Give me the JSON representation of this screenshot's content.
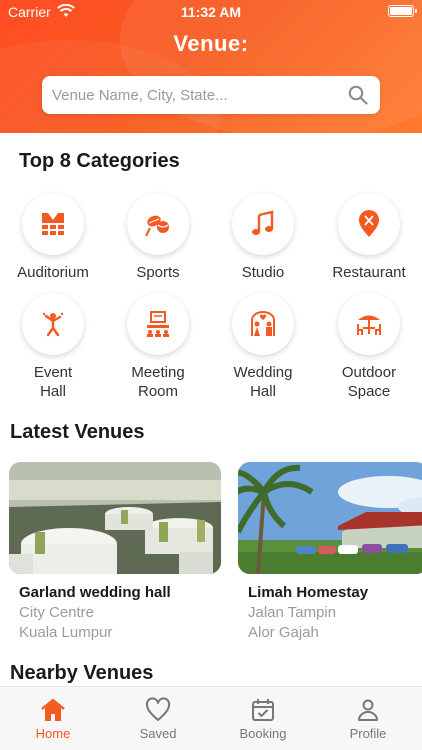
{
  "status_bar": {
    "carrier": "Carrier",
    "time": "11:32 AM"
  },
  "header": {
    "logo": "Venue:",
    "search_placeholder": "Venue Name, City, State..."
  },
  "categories": {
    "title": "Top 8 Categories",
    "items": [
      {
        "label": "Auditorium",
        "icon": "auditorium-icon"
      },
      {
        "label": "Sports",
        "icon": "sports-icon"
      },
      {
        "label": "Studio",
        "icon": "music-note-icon"
      },
      {
        "label": "Restaurant",
        "icon": "restaurant-icon"
      },
      {
        "label": "Event\nHall",
        "icon": "event-hall-icon"
      },
      {
        "label": "Meeting\nRoom",
        "icon": "meeting-room-icon"
      },
      {
        "label": "Wedding\nHall",
        "icon": "wedding-hall-icon"
      },
      {
        "label": "Outdoor\nSpace",
        "icon": "outdoor-space-icon"
      }
    ]
  },
  "latest": {
    "title": "Latest Venues",
    "items": [
      {
        "name": "Garland wedding hall",
        "area": "City Centre",
        "city": "Kuala Lumpur"
      },
      {
        "name": "Limah Homestay",
        "area": "Jalan Tampin",
        "city": "Alor Gajah"
      }
    ]
  },
  "nearby": {
    "title": "Nearby Venues"
  },
  "tabbar": {
    "items": [
      {
        "label": "Home",
        "icon": "home-icon",
        "active": true
      },
      {
        "label": "Saved",
        "icon": "heart-icon",
        "active": false
      },
      {
        "label": "Booking",
        "icon": "calendar-icon",
        "active": false
      },
      {
        "label": "Profile",
        "icon": "person-icon",
        "active": false
      }
    ]
  },
  "colors": {
    "accent": "#f35a22",
    "header": "#ff5a24"
  }
}
